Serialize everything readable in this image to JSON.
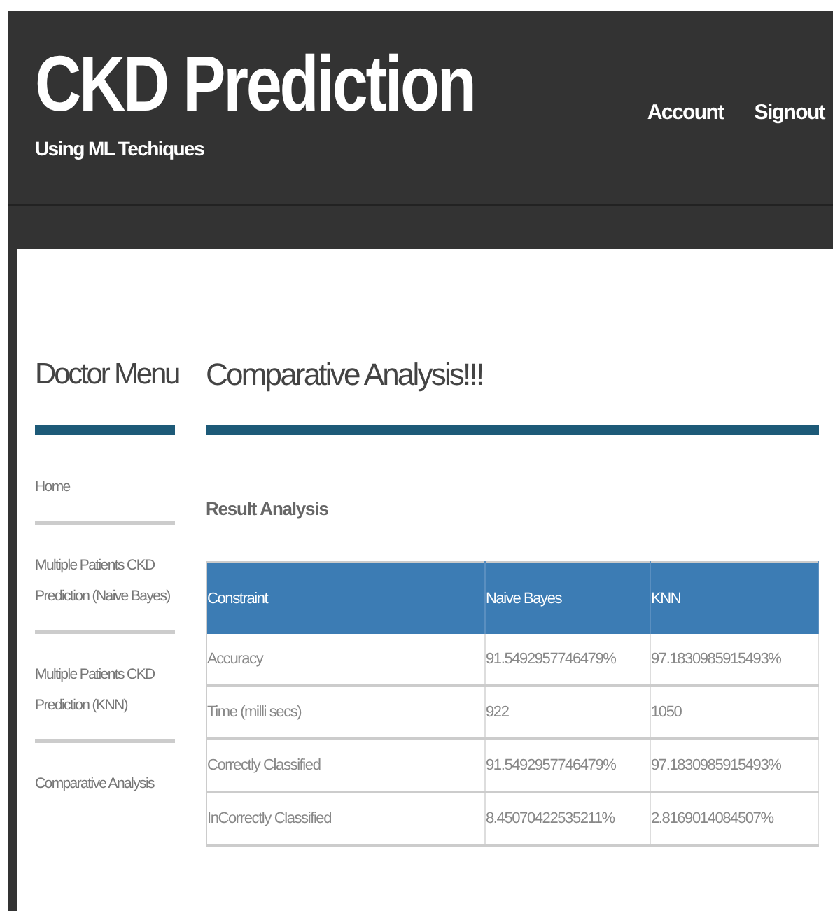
{
  "header": {
    "title": "CKD Prediction",
    "subtitle": "Using ML Techiques",
    "nav": [
      "Account",
      "Signout"
    ]
  },
  "sidebar": {
    "title": "Doctor Menu",
    "items": [
      "Home",
      "Multiple Patients CKD Prediction (Naive Bayes)",
      "Multiple Patients CKD Prediction (KNN)",
      "Comparative Analysis"
    ]
  },
  "main": {
    "title": "Comparative Analysis!!!",
    "subtitle": "Result Analysis",
    "table": {
      "columns": [
        "Constraint",
        "Naive Bayes",
        "KNN"
      ],
      "rows": [
        [
          "Accuracy",
          "91.5492957746479%",
          "97.1830985915493%"
        ],
        [
          "Time (milli secs)",
          "922",
          "1050"
        ],
        [
          "Correctly Classified",
          "91.5492957746479%",
          "97.1830985915493%"
        ],
        [
          "InCorrectly Classified",
          "8.45070422535211%",
          "2.8169014084507%"
        ]
      ]
    }
  }
}
